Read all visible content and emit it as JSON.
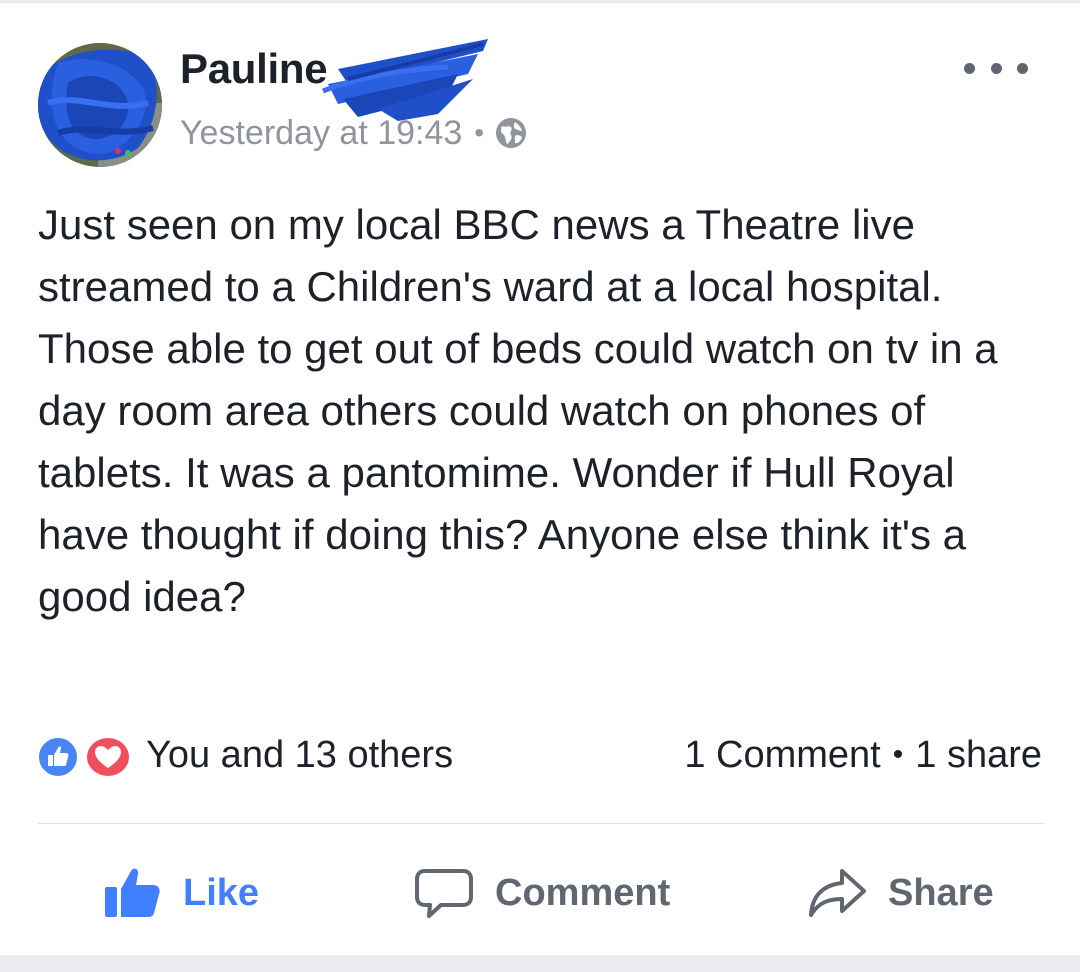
{
  "post": {
    "author": "Pauline",
    "timestamp": "Yesterday at 19:43",
    "privacy_icon": "globe-icon",
    "text": "Just seen on my local BBC news a Theatre live streamed to a Children's ward at a local hospital. Those able to get out of beds could watch on tv in a day room area others could watch on phones of tablets. It was a pantomime. Wonder if Hull Royal have thought if doing this? Anyone else think it's a good idea?",
    "reactions_text": "You and 13 others",
    "reaction_icons": [
      "like-reaction-icon",
      "love-reaction-icon"
    ],
    "comments_text": "1 Comment",
    "shares_text": "1 share"
  },
  "actions": {
    "like": "Like",
    "comment": "Comment",
    "share": "Share"
  },
  "colors": {
    "like_blue": "#4080ff",
    "love_red": "#ef4e5b",
    "scribble_blue": "#1f4fc9",
    "text": "#1d2129",
    "meta": "#90949c"
  }
}
